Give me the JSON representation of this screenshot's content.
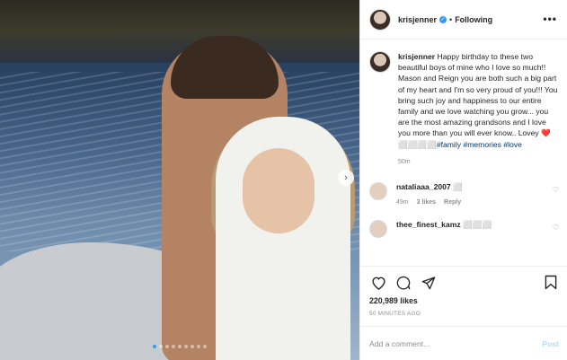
{
  "post": {
    "username": "krisjenner",
    "follow_sep": "•",
    "follow_label": "Following",
    "more_label": "•••",
    "verified_glyph": "✓"
  },
  "caption": {
    "username": "krisjenner",
    "text": "Happy birthday to these two beautiful boys of mine who I love so much!! Mason and Reign you are both such a big part of my heart and I'm so very proud of you!!! You bring such joy and happiness to our entire family and we love watching you grow... you are the most amazing grandsons and I love you more than you will ever know.. Lovey ❤️️⬜⬜⬜⬜",
    "tags": [
      "#family",
      "#memories",
      "#love"
    ],
    "time": "50m"
  },
  "comments": [
    {
      "username": "nataliaaa_2007",
      "text": "⬜",
      "time": "49m",
      "likes": "3 likes",
      "reply": "Reply"
    },
    {
      "username": "thee_finest_kamz",
      "text": "⬜⬜⬜",
      "time": "",
      "likes": "",
      "reply": ""
    }
  ],
  "stats": {
    "likes": "220,989 likes",
    "posted": "50 MINUTES AGO"
  },
  "composer": {
    "placeholder": "Add a comment...",
    "post_label": "Post"
  },
  "carousel": {
    "slide_count": 9,
    "active_index": 0
  },
  "icons": [
    "heart-icon",
    "comment-icon",
    "share-icon",
    "bookmark-icon",
    "next-arrow-icon",
    "more-options-icon",
    "verified-icon"
  ],
  "colors": {
    "accent": "#3897f0",
    "post_disabled": "#b2dffc",
    "hashtag": "#00376b"
  }
}
